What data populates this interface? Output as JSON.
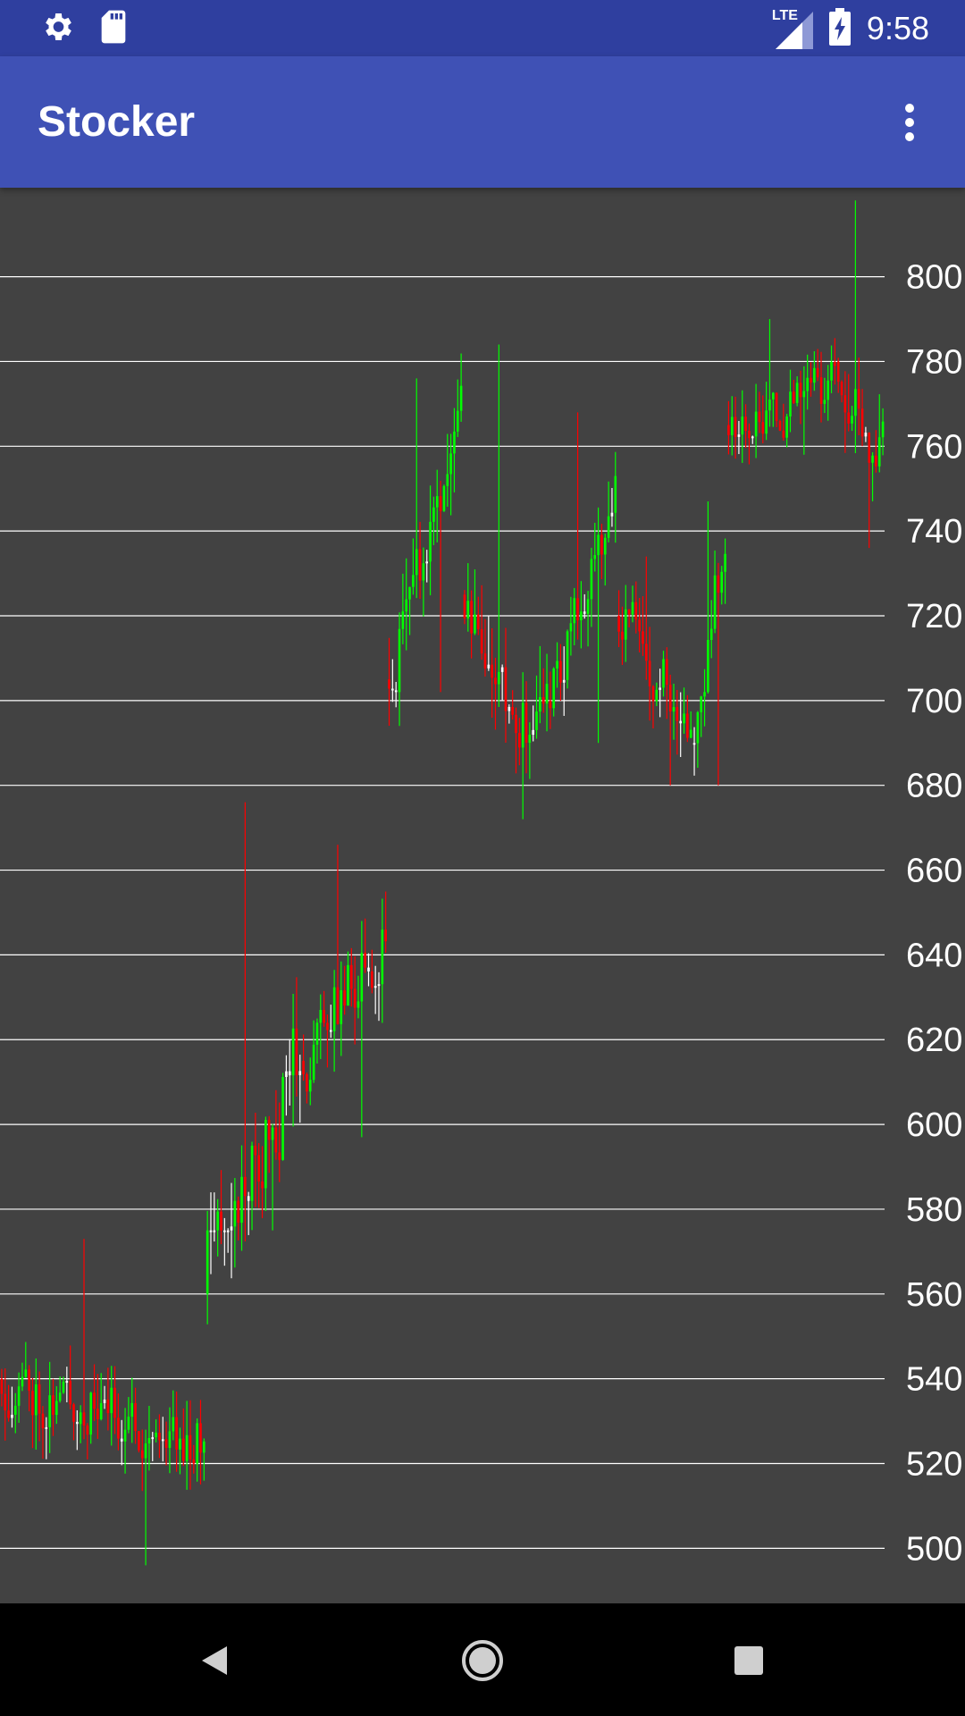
{
  "status_bar": {
    "time": "9:58",
    "network": "LTE",
    "icons": [
      "settings-icon",
      "sd-card-icon",
      "lte-signal-icon",
      "battery-charging-icon"
    ]
  },
  "app_bar": {
    "title": "Stocker",
    "menu_icon": "more-vert-icon",
    "background": "#3f51b5",
    "status_background": "#2f3f9f"
  },
  "nav_bar": {
    "icons": [
      "back-icon",
      "home-icon",
      "recents-icon"
    ]
  },
  "colors": {
    "up": "#00ff00",
    "down": "#ff0000",
    "neutral": "#ffffff",
    "background": "#424242",
    "grid": "#ffffff"
  },
  "chart_data": {
    "type": "candlestick",
    "ylim": [
      487,
      821
    ],
    "yticks": [
      500,
      520,
      540,
      560,
      580,
      600,
      620,
      640,
      660,
      680,
      700,
      720,
      740,
      760,
      780,
      800
    ],
    "grid": true,
    "axis_position": "right",
    "segments": [
      {
        "count": 60,
        "start": 540,
        "end": 525,
        "min": 496,
        "max": 573,
        "vol": 6,
        "seed": 11
      },
      {
        "count": 28,
        "start": 560,
        "end": 620,
        "min": 575,
        "max": 676,
        "vol": 9,
        "seed": 23
      },
      {
        "count": 25,
        "start": 615,
        "end": 645,
        "min": 597,
        "max": 666,
        "vol": 7,
        "seed": 37
      },
      {
        "count": 22,
        "start": 705,
        "end": 770,
        "min": 702,
        "max": 776,
        "vol": 7,
        "seed": 41
      },
      {
        "count": 25,
        "start": 725,
        "end": 690,
        "min": 672,
        "max": 784,
        "vol": 9,
        "seed": 53
      },
      {
        "count": 20,
        "start": 700,
        "end": 750,
        "min": 690,
        "max": 768,
        "vol": 6,
        "seed": 61
      },
      {
        "count": 22,
        "start": 720,
        "end": 695,
        "min": 680,
        "max": 734,
        "vol": 6,
        "seed": 71
      },
      {
        "count": 10,
        "start": 690,
        "end": 745,
        "min": 680,
        "max": 747,
        "vol": 6,
        "seed": 79
      },
      {
        "count": 32,
        "start": 765,
        "end": 775,
        "min": 758,
        "max": 790,
        "vol": 5,
        "seed": 83
      },
      {
        "count": 14,
        "start": 780,
        "end": 760,
        "min": 736,
        "max": 818,
        "vol": 8,
        "seed": 97
      }
    ]
  }
}
